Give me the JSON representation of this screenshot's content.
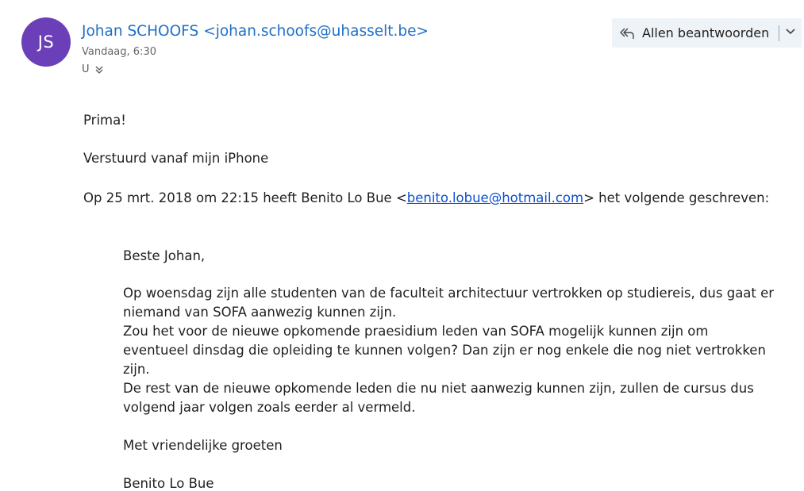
{
  "header": {
    "avatar_initials": "JS",
    "avatar_color": "#6b3fb8",
    "sender_name": "Johan SCHOOFS",
    "sender_email": "<johan.schoofs@uhasselt.be>",
    "date": "Vandaag, 6:30",
    "recipient": "U",
    "expand_icon": "double-chevron-down-icon"
  },
  "actions": {
    "reply_all_label": "Allen beantwoorden",
    "reply_all_icon": "reply-all-icon",
    "dropdown_icon": "chevron-down-icon"
  },
  "message": {
    "line1": "Prima!",
    "line2": "Verstuurd vanaf mijn iPhone",
    "quote_header_before": "Op 25 mrt. 2018 om 22:15 heeft Benito Lo Bue <",
    "quote_header_link": "benito.lobue@hotmail.com",
    "quote_header_after": "> het volgende geschreven:"
  },
  "quoted": {
    "greeting": "Beste Johan,",
    "body_lines": [
      "Op woensdag zijn alle studenten van de faculteit architectuur vertrokken op studiereis, dus gaat er",
      "niemand van SOFA aanwezig kunnen zijn.",
      "Zou het voor de nieuwe opkomende praesidium leden van SOFA mogelijk kunnen zijn om",
      "eventueel dinsdag die opleiding te kunnen volgen? Dan zijn er nog enkele die nog niet vertrokken",
      "zijn.",
      "De rest van de nieuwe opkomende leden die nu niet aanwezig kunnen zijn, zullen de cursus dus",
      "volgend jaar volgen zoals eerder al vermeld."
    ],
    "closing": "Met vriendelijke groeten",
    "signature": "Benito Lo Bue"
  }
}
